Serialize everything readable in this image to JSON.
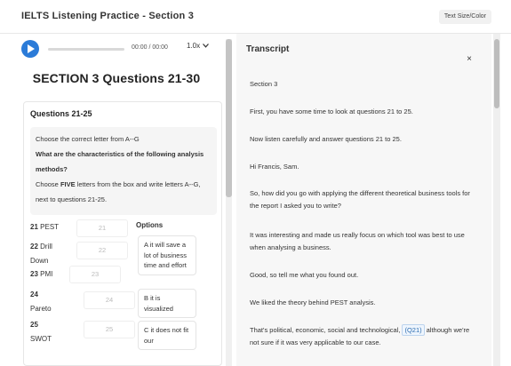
{
  "header": {
    "title": "IELTS Listening Practice - Section 3",
    "text_size_button": "Text Size/Color"
  },
  "audio": {
    "time": "00:00 / 00:00",
    "speed": "1.0x",
    "progress": 0,
    "play_icon": "play-icon"
  },
  "section_title": "SECTION 3 Questions 21-30",
  "question_group": {
    "heading": "Questions 21-25",
    "instruction_line1": "Choose the correct letter from A--G",
    "instruction_question": "What are the characteristics of the following analysis methods?",
    "instruction_choose": "Choose ",
    "instruction_five": "FIVE",
    "instruction_rest": " letters from the box and write letters A--G, next to questions 21-25.",
    "items": [
      {
        "num": "21",
        "label": "PEST",
        "placeholder": "21"
      },
      {
        "num": "22",
        "label": "Drill Down",
        "placeholder": "22"
      },
      {
        "num": "23",
        "label": "PMI",
        "placeholder": "23"
      },
      {
        "num": "24",
        "label": "Pareto",
        "placeholder": "24"
      },
      {
        "num": "25",
        "label": "SWOT",
        "placeholder": "25"
      }
    ],
    "options_label": "Options",
    "options": [
      "A it will save a lot of business time and effort",
      "B it is visualized",
      "C it does not fit our"
    ]
  },
  "transcript": {
    "title": "Transcript",
    "close_icon": "close-icon",
    "paragraphs": [
      "Section 3",
      "First, you have some time to look at questions 21 to 25.",
      "Now listen carefully and answer questions 21 to 25.",
      "Hi Francis, Sam.",
      "So, how did you go with applying the different theoretical business tools for the report I asked you to write?",
      "It was interesting and made us really focus on which tool was best to use when analysing a business.",
      "Good, so tell me what you found out.",
      "We liked the theory behind PEST analysis."
    ],
    "last_para_before": "That's political, economic, social and technological,",
    "last_para_tag": "(Q21)",
    "last_para_after": "although we're not sure if it was very applicable to our case."
  }
}
